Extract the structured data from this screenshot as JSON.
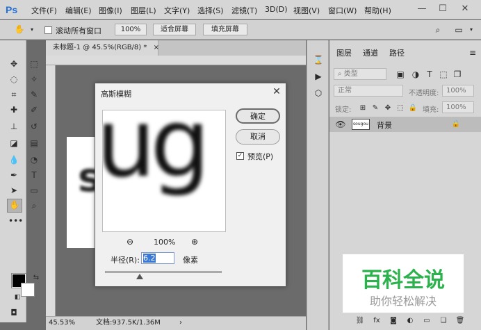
{
  "app": {
    "logo": "Ps",
    "menu": [
      "文件(F)",
      "编辑(E)",
      "图像(I)",
      "图层(L)",
      "文字(Y)",
      "选择(S)",
      "滤镜(T)",
      "3D(D)",
      "视图(V)",
      "窗口(W)",
      "帮助(H)"
    ],
    "window_controls": [
      "—",
      "☐",
      "✕"
    ]
  },
  "options_bar": {
    "scroll_all_windows": "滚动所有窗口",
    "zoom": "100%",
    "fit_screen": "适合屏幕",
    "fill_screen": "填充屏幕"
  },
  "document": {
    "tab_title": "未标题-1 @ 45.5%(RGB/8) *",
    "tab_close": "×",
    "canvas_text": "s",
    "status_zoom": "45.53%",
    "status_doc": "文档:937.5K/1.36M"
  },
  "layers_panel": {
    "tabs": [
      "图层",
      "通道",
      "路径"
    ],
    "filter_kind": "类型",
    "blend_mode": "正常",
    "opacity_label": "不透明度:",
    "opacity": "100%",
    "lock_label": "锁定:",
    "fill_label": "填充:",
    "fill": "100%",
    "layer_name": "背景",
    "layer_thumb_text": "sougou"
  },
  "dialog": {
    "title": "高斯模糊",
    "close": "✕",
    "ok": "确定",
    "cancel": "取消",
    "preview_label": "预览(P)",
    "preview_checked": true,
    "preview_text": "ug",
    "zoom": "100%",
    "radius_label": "半径(R):",
    "radius_value": "6.2",
    "radius_unit": "像素",
    "radius_slider_fraction": 0.3
  },
  "watermark": {
    "main": "百科全说",
    "sub": "助你轻松解决"
  },
  "colors": {
    "chrome": "#d6d6d6",
    "workspace": "#6b6b6b",
    "dialog": "#f0f0f0",
    "accent": "#3a78d6",
    "watermark_green": "#2bb24c"
  }
}
